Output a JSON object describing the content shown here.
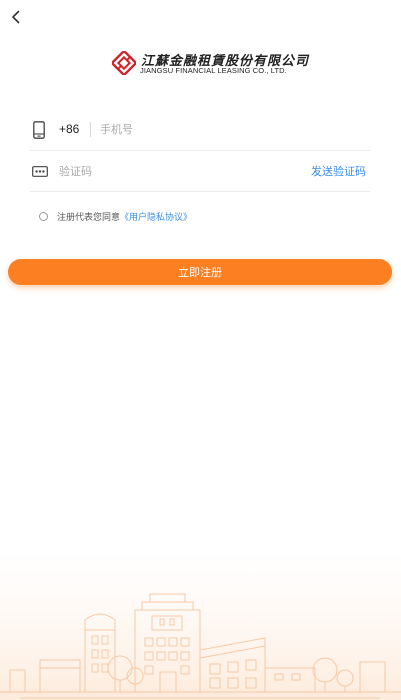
{
  "nav": {
    "back_icon": "chevron-left-icon"
  },
  "logo": {
    "cn_name": "江蘇金融租賃股份有限公司",
    "en_name": "JIANGSU FINANCIAL LEASING CO., LTD."
  },
  "form": {
    "phone": {
      "icon": "mobile-phone-icon",
      "country_code": "+86",
      "placeholder": "手机号",
      "value": ""
    },
    "code": {
      "icon": "password-dots-icon",
      "placeholder": "验证码",
      "value": "",
      "send_label": "发送验证码"
    },
    "agreement": {
      "checked": false,
      "prefix": "注册代表您同意",
      "link_label": "《用户隐私协议》"
    },
    "submit_label": "立即注册"
  },
  "colors": {
    "accent": "#fc7f22",
    "link": "#3a8ee6",
    "logo_red": "#d2232a"
  }
}
